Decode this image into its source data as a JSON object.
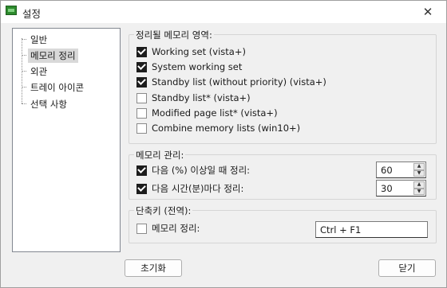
{
  "window": {
    "title": "설정",
    "close_glyph": "✕"
  },
  "tree": {
    "items": [
      {
        "label": "일반"
      },
      {
        "label": "메모리 정리"
      },
      {
        "label": "외관"
      },
      {
        "label": "트레이 아이콘"
      },
      {
        "label": "선택 사항"
      }
    ],
    "selected_index": 1
  },
  "memory_area": {
    "title": "정리될 메모리 영역:",
    "options": [
      {
        "label": "Working set (vista+)",
        "checked": true
      },
      {
        "label": "System working set",
        "checked": true
      },
      {
        "label": "Standby list (without priority) (vista+)",
        "checked": true
      },
      {
        "label": "Standby list* (vista+)",
        "checked": false
      },
      {
        "label": "Modified page list* (vista+)",
        "checked": false
      },
      {
        "label": "Combine memory lists (win10+)",
        "checked": false
      }
    ]
  },
  "memory_mgmt": {
    "title": "메모리 관리:",
    "percent": {
      "label": "다음 (%) 이상일 때 정리:",
      "checked": true,
      "value": "60"
    },
    "interval": {
      "label": "다음 시간(분)마다 정리:",
      "checked": true,
      "value": "30"
    }
  },
  "hotkey": {
    "title": "단축키 (전역):",
    "label": "메모리 정리:",
    "checked": false,
    "value": "Ctrl + F1"
  },
  "buttons": {
    "reset": "초기화",
    "close": "닫기"
  }
}
